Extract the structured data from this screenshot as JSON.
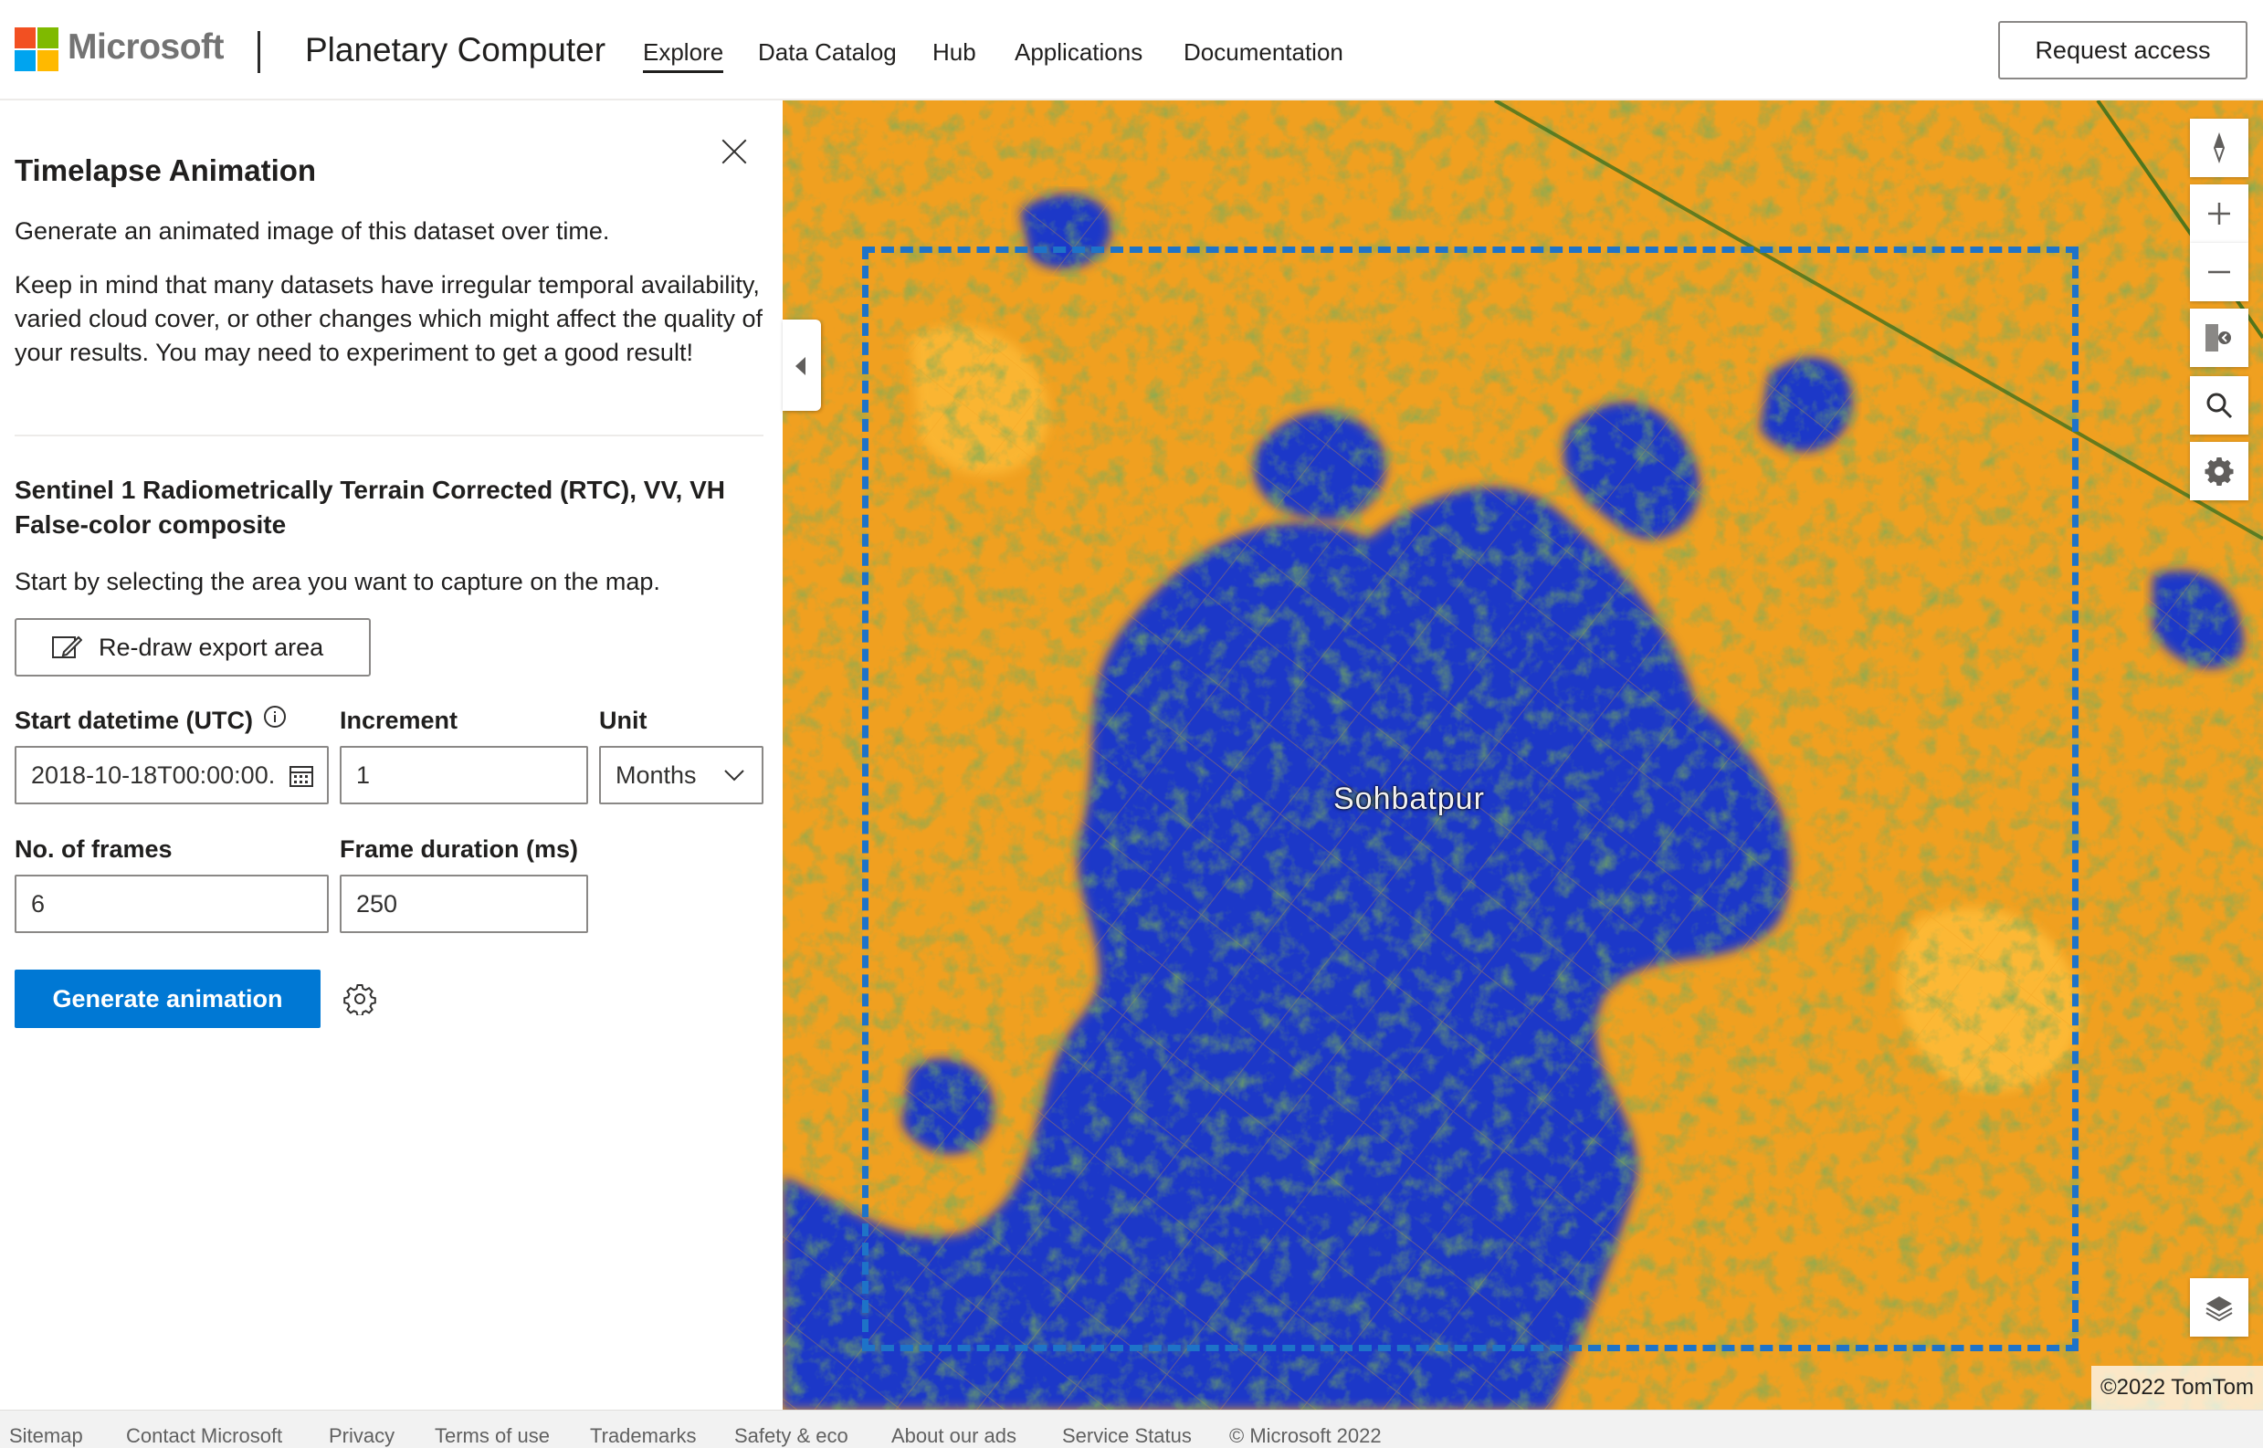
{
  "header": {
    "brand": "Microsoft",
    "app_title": "Planetary Computer",
    "nav": [
      "Explore",
      "Data Catalog",
      "Hub",
      "Applications",
      "Documentation"
    ],
    "active_nav": "Explore",
    "request_access": "Request access"
  },
  "panel": {
    "title": "Timelapse Animation",
    "intro": "Generate an animated image of this dataset over time.",
    "note": "Keep in mind that many datasets have irregular temporal availability, varied cloud cover, or other changes which might affect the quality of your results. You may need to experiment to get a good result!",
    "dataset_title": "Sentinel 1 Radiometrically Terrain Corrected (RTC), VV, VH False-color composite",
    "start_prompt": "Start by selecting the area you want to capture on the map.",
    "redraw_label": "Re-draw export area",
    "fields": {
      "start_label": "Start datetime (UTC)",
      "start_value": "2018-10-18T00:00:00.",
      "increment_label": "Increment",
      "increment_value": "1",
      "unit_label": "Unit",
      "unit_value": "Months",
      "frames_label": "No. of frames",
      "frames_value": "6",
      "duration_label": "Frame duration (ms)",
      "duration_value": "250"
    },
    "generate_label": "Generate animation"
  },
  "map": {
    "place_label": "Sohbatpur",
    "attribution": "©2022 TomTom",
    "colors": {
      "orange": "#f0a020",
      "blue": "#1f38c8",
      "green": "#2e6b1a",
      "export_border": "#1e73c8"
    }
  },
  "footer": {
    "links": [
      "Sitemap",
      "Contact Microsoft",
      "Privacy",
      "Terms of use",
      "Trademarks",
      "Safety & eco",
      "About our ads",
      "Service Status"
    ],
    "copyright": "© Microsoft 2022"
  }
}
